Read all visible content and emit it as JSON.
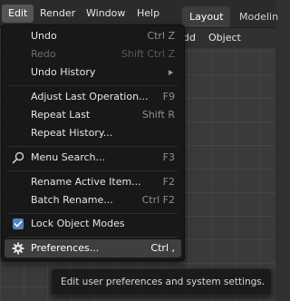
{
  "menubar": {
    "items": [
      "Edit",
      "Render",
      "Window",
      "Help"
    ],
    "tabs": [
      "Layout",
      "Modelin"
    ]
  },
  "viewport_header": {
    "items": [
      "dd",
      "Object"
    ]
  },
  "edit_menu": {
    "items": [
      {
        "label": "Undo",
        "shortcut": "Ctrl Z",
        "disabled": false
      },
      {
        "label": "Redo",
        "shortcut": "Shift Ctrl Z",
        "disabled": true
      },
      {
        "label": "Undo History",
        "shortcut": "",
        "submenu": true
      },
      {
        "label": "Adjust Last Operation...",
        "shortcut": "F9"
      },
      {
        "label": "Repeat Last",
        "shortcut": "Shift R"
      },
      {
        "label": "Repeat History...",
        "shortcut": ""
      },
      {
        "label": "Menu Search...",
        "shortcut": "F3",
        "icon": "search-icon"
      },
      {
        "label": "Rename Active Item...",
        "shortcut": "F2"
      },
      {
        "label": "Batch Rename...",
        "shortcut": "Ctrl F2"
      },
      {
        "label": "Lock Object Modes",
        "shortcut": "",
        "icon": "checkbox-checked-icon",
        "checked": true
      },
      {
        "label": "Preferences...",
        "shortcut": "Ctrl ,",
        "icon": "gear-icon",
        "highlighted": true
      }
    ]
  },
  "tooltip": {
    "text": "Edit user preferences and system settings."
  },
  "colors": {
    "menu_bg": "#181818",
    "highlight": "#3f3f3f",
    "checkbox": "#5680c2"
  }
}
